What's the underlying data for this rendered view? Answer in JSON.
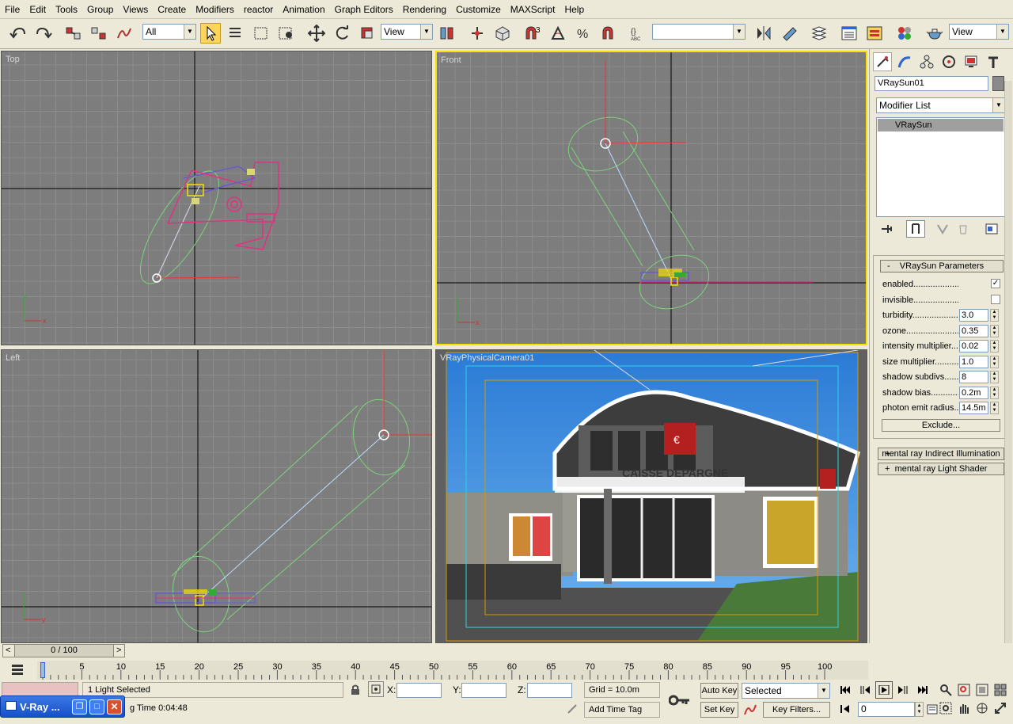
{
  "menu": [
    "File",
    "Edit",
    "Tools",
    "Group",
    "Views",
    "Create",
    "Modifiers",
    "reactor",
    "Animation",
    "Graph Editors",
    "Rendering",
    "Customize",
    "MAXScript",
    "Help"
  ],
  "toolbar": {
    "filter_value": "All",
    "refcoord_value": "View",
    "named_sel_value": "",
    "render_view_value": "View",
    "snap_label": "3",
    "colors": {
      "active_tool": "#fdd55a"
    }
  },
  "viewports": {
    "top": {
      "label": "Top"
    },
    "front": {
      "label": "Front"
    },
    "left": {
      "label": "Left"
    },
    "camera": {
      "label": "VRayPhysicalCamera01",
      "sign_text": "CAISSE DEPARGNE"
    }
  },
  "axis_labels": {
    "x": "x",
    "y": "y",
    "z": "z"
  },
  "command_panel": {
    "object_name": "VRaySun01",
    "modifier_list": "Modifier List",
    "stack_item": "VRaySun",
    "rollout_title": "VRaySun Parameters",
    "rollout_prefix": "-",
    "params": [
      {
        "label": "enabled.....................................",
        "type": "check",
        "value": "✓"
      },
      {
        "label": "invisible.....................................",
        "type": "check",
        "value": ""
      },
      {
        "label": "turbidity.....................................",
        "type": "spin",
        "value": "3.0"
      },
      {
        "label": "ozone.........................................",
        "type": "spin",
        "value": "0.35"
      },
      {
        "label": "intensity multiplier....",
        "type": "spin",
        "value": "0.02"
      },
      {
        "label": "size multiplier............",
        "type": "spin",
        "value": "1.0"
      },
      {
        "label": "shadow subdivs.........",
        "type": "spin",
        "value": "8"
      },
      {
        "label": "shadow bias.................",
        "type": "spin",
        "value": "0.2m"
      },
      {
        "label": "photon emit radius..",
        "type": "spin",
        "value": "14.5m"
      }
    ],
    "exclude_button": "Exclude...",
    "rollout2": "mental ray Indirect Illumination",
    "rollout2_prefix": "+",
    "rollout3": "mental ray Light Shader",
    "rollout3_prefix": "+"
  },
  "timeline": {
    "slider_label": "0 / 100",
    "prev_arrow": "<",
    "next_arrow": ">",
    "ticks": [
      "0",
      "5",
      "10",
      "15",
      "20",
      "25",
      "30",
      "35",
      "40",
      "45",
      "50",
      "55",
      "60",
      "65",
      "70",
      "75",
      "80",
      "85",
      "90",
      "95",
      "100"
    ]
  },
  "status": {
    "selection": "1 Light Selected",
    "render_time": "g Time  0:04:48",
    "x_label": "X:",
    "y_label": "Y:",
    "z_label": "Z:",
    "grid": "Grid = 10.0m",
    "add_time_tag": "Add Time Tag",
    "auto_key": "Auto Key",
    "set_key": "Set Key",
    "selected_dropdown": "Selected",
    "key_filters": "Key Filters...",
    "frame_value": "0"
  },
  "taskbar": {
    "title": "V-Ray ..."
  }
}
